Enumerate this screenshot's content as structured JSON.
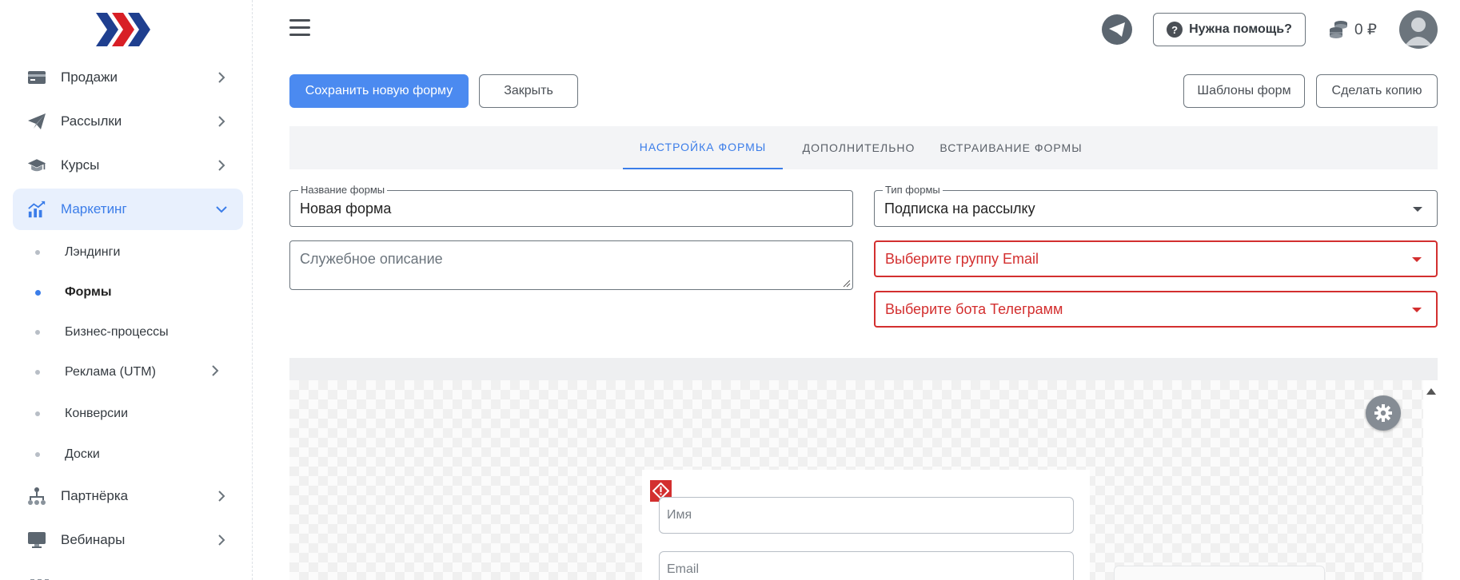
{
  "sidebar": {
    "items": [
      {
        "label": "Продажи",
        "icon": "wallet-icon"
      },
      {
        "label": "Рассылки",
        "icon": "paper-plane-icon"
      },
      {
        "label": "Курсы",
        "icon": "graduation-cap-icon"
      },
      {
        "label": "Маркетинг",
        "icon": "chart-up-icon",
        "active": true
      },
      {
        "label": "Партнёрка",
        "icon": "network-icon"
      },
      {
        "label": "Вебинары",
        "icon": "monitor-icon"
      }
    ],
    "sub_items": [
      {
        "label": "Лэндинги"
      },
      {
        "label": "Формы",
        "active": true
      },
      {
        "label": "Бизнес-процессы"
      },
      {
        "label": "Реклама (UTM)"
      },
      {
        "label": "Конверсии"
      },
      {
        "label": "Доски"
      }
    ]
  },
  "header": {
    "help_label": "Нужна помощь?",
    "balance": "0 ₽"
  },
  "toolbar": {
    "save_label": "Сохранить новую форму",
    "close_label": "Закрыть",
    "templates_label": "Шаблоны форм",
    "copy_label": "Сделать копию"
  },
  "tabs": [
    {
      "label": "НАСТРОЙКА ФОРМЫ",
      "active": true
    },
    {
      "label": "ДОПОЛНИТЕЛЬНО"
    },
    {
      "label": "ВСТРАИВАНИЕ ФОРМЫ"
    }
  ],
  "form": {
    "name_label": "Название формы",
    "name_value": "Новая форма",
    "description_placeholder": "Служебное описание",
    "type_label": "Тип формы",
    "type_value": "Подписка на рассылку",
    "email_group_placeholder": "Выберите группу Email",
    "telegram_bot_placeholder": "Выберите бота Телеграмм"
  },
  "preview": {
    "name_placeholder": "Имя",
    "email_placeholder": "Email"
  },
  "colors": {
    "primary": "#4b8af0",
    "accent": "#3b7de9",
    "error": "#d32f2f",
    "logo_blue": "#1f3f8f",
    "logo_red": "#d81f26"
  }
}
